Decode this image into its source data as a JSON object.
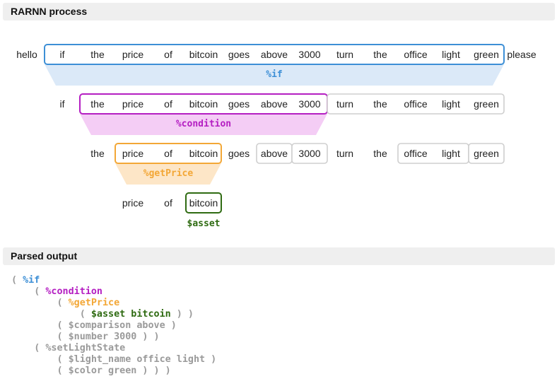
{
  "sections": {
    "process_title": "RARNN process",
    "output_title": "Parsed output"
  },
  "colors": {
    "if": "#3d8fd6",
    "if_fill": "#dbe9f8",
    "condition": "#b41ec2",
    "condition_fill": "#f4cdf5",
    "getPrice": "#f3a736",
    "getPrice_fill": "#fde6c7",
    "asset": "#2f6b12",
    "neutral_box": "#cfcfcf",
    "muted_text": "#9a9a9a"
  },
  "levels": [
    {
      "words": [
        "hello",
        "if",
        "the",
        "price",
        "of",
        "bitcoin",
        "goes",
        "above",
        "3000",
        "turn",
        "the",
        "office",
        "light",
        "green",
        "please"
      ],
      "boxes": [
        {
          "from": 1,
          "to": 13,
          "kind": "if"
        }
      ],
      "funnel": {
        "label": "%if",
        "kind": "if"
      }
    },
    {
      "words": [
        "if",
        "the",
        "price",
        "of",
        "bitcoin",
        "goes",
        "above",
        "3000",
        "turn",
        "the",
        "office",
        "light",
        "green"
      ],
      "boxes": [
        {
          "from": 1,
          "to": 7,
          "kind": "condition"
        },
        {
          "from": 8,
          "to": 12,
          "kind": "neutral"
        }
      ],
      "funnel": {
        "label": "%condition",
        "kind": "condition"
      }
    },
    {
      "words": [
        "the",
        "price",
        "of",
        "bitcoin",
        "goes",
        "above",
        "3000",
        "turn",
        "the",
        "office",
        "light",
        "green"
      ],
      "boxes": [
        {
          "from": 1,
          "to": 3,
          "kind": "getPrice"
        },
        {
          "from": 5,
          "to": 5,
          "kind": "neutral"
        },
        {
          "from": 6,
          "to": 6,
          "kind": "neutral"
        },
        {
          "from": 9,
          "to": 10,
          "kind": "neutral"
        },
        {
          "from": 11,
          "to": 11,
          "kind": "neutral"
        }
      ],
      "funnel": {
        "label": "%getPrice",
        "kind": "getPrice"
      }
    },
    {
      "words": [
        "price",
        "of",
        "bitcoin"
      ],
      "boxes": [
        {
          "from": 2,
          "to": 2,
          "kind": "asset"
        }
      ],
      "tag": {
        "label": "$asset",
        "kind": "asset"
      }
    }
  ],
  "parsed_output": [
    [
      {
        "t": "( ",
        "k": "p"
      },
      {
        "t": "%if",
        "k": "if"
      }
    ],
    [
      {
        "t": "    ( ",
        "k": "p"
      },
      {
        "t": "%condition",
        "k": "cond"
      }
    ],
    [
      {
        "t": "        ( ",
        "k": "p"
      },
      {
        "t": "%getPrice",
        "k": "price"
      }
    ],
    [
      {
        "t": "            ( ",
        "k": "p"
      },
      {
        "t": "$asset bitcoin",
        "k": "asset"
      },
      {
        "t": " ) )",
        "k": "p"
      }
    ],
    [
      {
        "t": "        ( $comparison above )",
        "k": "p"
      }
    ],
    [
      {
        "t": "        ( $number 3000 ) )",
        "k": "p"
      }
    ],
    [
      {
        "t": "    ( %setLightState",
        "k": "p"
      }
    ],
    [
      {
        "t": "        ( $light_name office light )",
        "k": "p"
      }
    ],
    [
      {
        "t": "        ( $color green ) ) )",
        "k": "p"
      }
    ]
  ]
}
